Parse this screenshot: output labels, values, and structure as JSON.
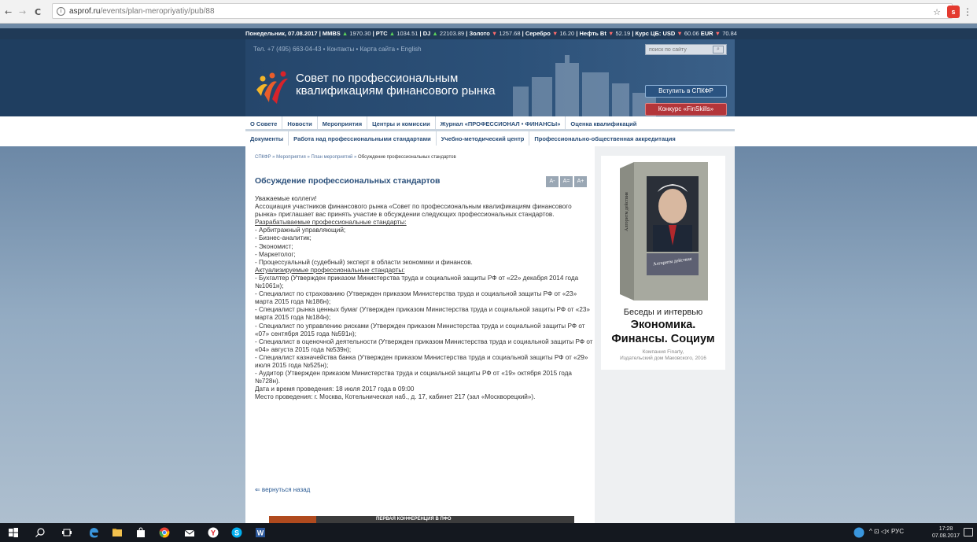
{
  "browser": {
    "url_host": "asprof.ru",
    "url_path": "/events/plan-meropriyatiy/pub/88",
    "back": "←",
    "forward": "→",
    "reload": "C",
    "star": "☆",
    "ext_badge": "s",
    "menu": "⋮"
  },
  "ticker": {
    "date": "Понедельник, 07.08.2017",
    "items": [
      {
        "name": "MMBS",
        "dir": "▲",
        "value": "1970.30"
      },
      {
        "name": "РТС",
        "dir": "▲",
        "value": "1034.51"
      },
      {
        "name": "DJ",
        "dir": "▲",
        "value": "22103.89"
      },
      {
        "name": "Золото",
        "dir": "▼",
        "value": "1257.68"
      },
      {
        "name": "Серебро",
        "dir": "▼",
        "value": "16.20"
      },
      {
        "name": "Нефть Bt",
        "dir": "▼",
        "value": "52.19"
      }
    ],
    "rates_label": "Курс ЦБ:",
    "usd_label": "USD",
    "usd_dir": "▼",
    "usd_value": "60.06",
    "eur_label": "EUR",
    "eur_dir": "▼",
    "eur_value": "70.84"
  },
  "header": {
    "top_links": "Тел. +7 (495) 663-04-43  •  Контакты  •  Карта сайта  •  English",
    "search_placeholder": "поиск по сайту",
    "search_icon": "⌕",
    "title_line1": "Совет по профессиональным",
    "title_line2": "квалификациям финансового рынка",
    "join_button": "Вступить в СПКФР",
    "contest_button": "Конкурс «FinSkills»"
  },
  "menu_primary": [
    "О Совете",
    "Новости",
    "Мероприятия",
    "Центры и комиссии",
    "Журнал «ПРОФЕССИОНАЛ • ФИНАНСЫ»",
    "Оценка квалификаций"
  ],
  "menu_secondary": [
    "Документы",
    "Работа над профессиональными стандартами",
    "Учебно-методический центр",
    "Профессионально-общественная аккредитация"
  ],
  "breadcrumb": {
    "items": [
      "СПКФР",
      "Мероприятия",
      "План мероприятий"
    ],
    "sep": "»",
    "current": "Обсуждение профессиональных стандартов"
  },
  "article": {
    "title": "Обсуждение профессиональных стандартов",
    "font_buttons": [
      "A-",
      "A=",
      "A+"
    ],
    "greeting": "Уважаемые коллеги!",
    "intro": "Ассоциация участников финансового рынка «Совет по профессиональным квалификациям финансового рынка» приглашает вас принять участие в обсуждении следующих профессиональных стандартов.",
    "developed_heading": "Разрабатываемые профессиональные стандарты:",
    "developed": [
      "- Арбитражный управляющий;",
      "- Бизнес-аналитик;",
      "- Экономист;",
      "- Маркетолог;",
      "- Процессуальный (судебный) эксперт в области экономики и финансов."
    ],
    "updated_heading": "Актуализируемые профессиональные стандарты:",
    "updated": [
      "- Бухгалтер (Утвержден приказом Министерства труда и социальной защиты РФ от «22» декабря 2014 года №1061н);",
      "- Специалист по страхованию (Утвержден приказом Министерства труда и социальной защиты РФ от «23» марта 2015 года №186н);",
      "- Специалист рынка ценных бумаг (Утвержден приказом Министерства труда и социальной защиты РФ от «23» марта 2015 года №184н);",
      "- Специалист по управлению рисками (Утвержден приказом Министерства труда и социальной защиты РФ от «07» сентября 2015 года №591н);",
      "- Специалист в оценочной деятельности (Утвержден приказом Министерства труда и социальной защиты РФ от «04» августа 2015 года №539н);",
      "- Специалист казначейства банка (Утвержден приказом Министерства труда и социальной защиты РФ от «29» июля 2015 года №525н);",
      "- Аудитор (Утвержден приказом Министерства труда и социальной защиты РФ от «19» октября 2015 года №728н)."
    ],
    "datetime": "Дата и время проведения: 18 июля 2017 года в 09:00",
    "place": "Место проведения: г. Москва, Котельническая наб., д. 17, кабинет 217 (зал «Москворецкий»).",
    "back_link": "⇐ вернуться назад",
    "promo_text": "ПЕРВАЯ КОНФЕРЕНЦИЯ В ПФО"
  },
  "ad": {
    "line1": "Беседы и интервью",
    "line2": "Экономика.",
    "line3": "Финансы. Социум",
    "line4a": "Компания Finarty,",
    "line4b": "Издательский дом Маковского, 2016",
    "book_spine": "Алгоритм действия",
    "book_cover": "Алгоритм действия"
  },
  "taskbar": {
    "tray_text": "^  ⊡  ◁×  РУС",
    "time": "17:28",
    "date": "07.08.2017"
  },
  "colors": {
    "ticker_bg": "#203a57",
    "header_bg": "#1f3e60",
    "menu_text": "#274c77",
    "title_blue": "#2a4f7a",
    "contest_red": "#b3353a"
  }
}
